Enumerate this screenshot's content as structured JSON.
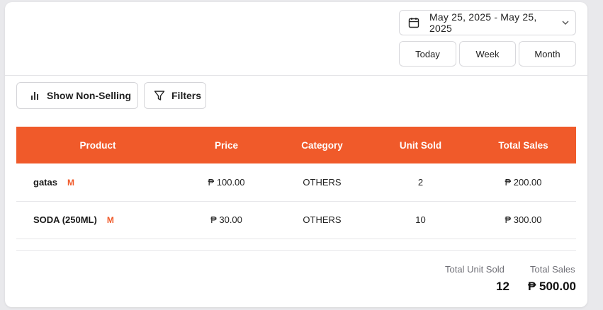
{
  "date_picker": {
    "range": "May 25, 2025 - May 25, 2025"
  },
  "period_buttons": {
    "today": "Today",
    "week": "Week",
    "month": "Month"
  },
  "toolbar": {
    "non_selling_label": "Show Non-Selling",
    "filters_label": "Filters"
  },
  "table": {
    "headers": {
      "product": "Product",
      "price": "Price",
      "category": "Category",
      "unit_sold": "Unit Sold",
      "total_sales": "Total Sales"
    },
    "rows": [
      {
        "product": "gatas",
        "badge": "M",
        "price": "₱ 100.00",
        "category": "OTHERS",
        "unit_sold": "2",
        "total_sales": "₱ 200.00"
      },
      {
        "product": "SODA (250ML)",
        "badge": "M",
        "price": "₱ 30.00",
        "category": "OTHERS",
        "unit_sold": "10",
        "total_sales": "₱ 300.00"
      }
    ]
  },
  "totals": {
    "unit_sold_label": "Total Unit Sold",
    "unit_sold_value": "12",
    "sales_label": "Total Sales",
    "sales_value": "₱ 500.00"
  },
  "colors": {
    "accent": "#f05a2a"
  },
  "icons": {
    "date": "calendar-icon",
    "dropdown": "chevron-down-icon",
    "non_selling": "bar-chart-icon",
    "filters": "filter-icon"
  }
}
